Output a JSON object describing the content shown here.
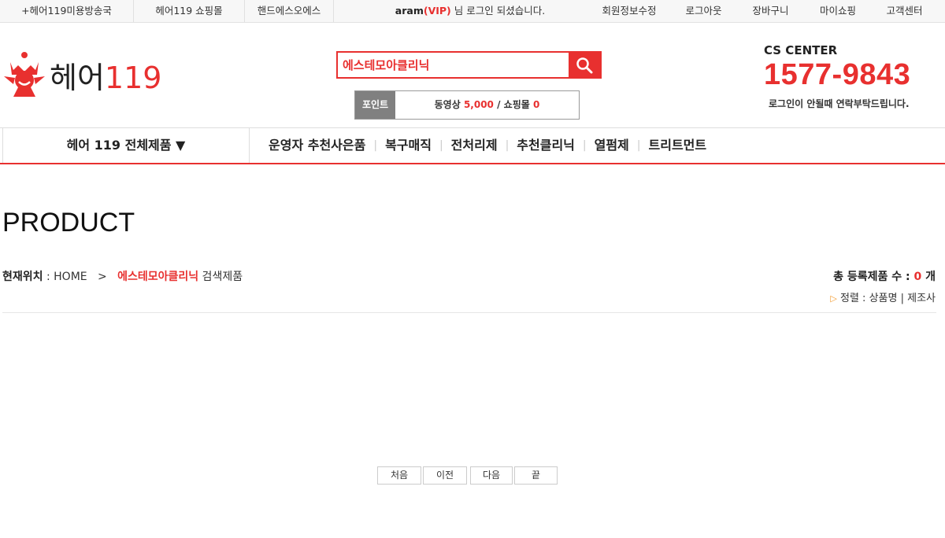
{
  "topbar": {
    "links": [
      "+헤어119미용방송국",
      "헤어119 쇼핑몰",
      "핸드에스오에스"
    ],
    "welcome": {
      "user": "aram",
      "grade": "(VIP)",
      "suffix": " 님 로그인 되셨습니다."
    },
    "right_links": [
      "회원정보수정",
      "로그아웃",
      "장바구니",
      "마이쇼핑",
      "고객센터"
    ]
  },
  "logo": {
    "text_main": "헤어",
    "text_num": "119"
  },
  "search": {
    "value": "에스테모아클리닉"
  },
  "points": {
    "label": "포인트",
    "video_label": "동영상",
    "video_value": "5,000",
    "sep": " / ",
    "shop_label": "쇼핑몰",
    "shop_value": "0"
  },
  "cs": {
    "title": "CS CENTER",
    "phone": "1577-9843",
    "note": "로그인이 안될때 연락부탁드립니다."
  },
  "nav": {
    "all_label": "헤어 119 전체제품 ▼",
    "items": [
      "운영자 추천사은품",
      "복구매직",
      "전처리제",
      "추천클리닉",
      "열펌제",
      "트리트먼트"
    ]
  },
  "content": {
    "title": "PRODUCT",
    "breadcrumb": {
      "label": "현재위치",
      "sep1": " : HOME   >   ",
      "keyword": "에스테모아클리닉",
      "suffix": " 검색제품"
    },
    "total": {
      "label": "총 등록제품 수 : ",
      "count": "0",
      "unit": " 개"
    },
    "sort": {
      "label": "정렬 : ",
      "opt1": "상품명",
      "divider": " | ",
      "opt2": "제조사"
    }
  },
  "pager": {
    "first": "처음",
    "prev": "이전",
    "next": "다음",
    "last": "끝"
  },
  "colors": {
    "accent": "#e8302f",
    "gray": "#808080"
  }
}
